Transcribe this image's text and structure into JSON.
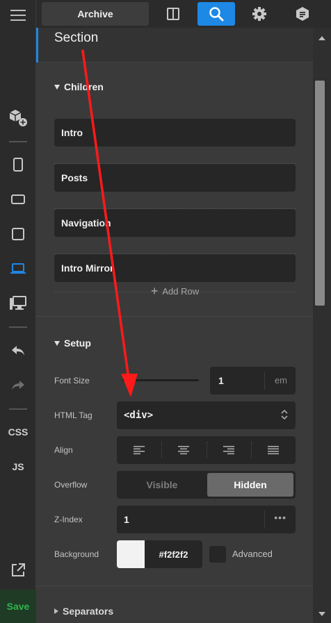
{
  "app": {
    "accent_color": "#1e88e5",
    "save_color": "#2fb34c"
  },
  "rail": {
    "items": [
      {
        "icon": "hamburger-menu-icon"
      },
      {
        "icon": "add-component-icon"
      },
      {
        "icon": "phone-portrait-icon"
      },
      {
        "icon": "phone-landscape-icon"
      },
      {
        "icon": "tablet-icon"
      },
      {
        "icon": "laptop-icon",
        "active": true
      },
      {
        "icon": "desktop-icon"
      },
      {
        "icon": "undo-icon"
      },
      {
        "icon": "redo-icon"
      },
      {
        "icon": "external-link-icon"
      }
    ],
    "css_label": "CSS",
    "js_label": "JS",
    "save_label": "Save"
  },
  "topbar": {
    "archive_label": "Archive",
    "icons": [
      "split-layout-icon",
      "search-icon",
      "settings-gear-icon",
      "notes-icon"
    ],
    "active_icon": "search-icon"
  },
  "section": {
    "title": "Section"
  },
  "children": {
    "title": "Children",
    "rows": [
      "Intro",
      "Posts",
      "Navigation",
      "Intro Mirror"
    ],
    "add_row_label": "Add Row"
  },
  "setup": {
    "title": "Setup",
    "font_size": {
      "label": "Font Size",
      "value": "1",
      "unit": "em",
      "slider_fraction": 0.1
    },
    "html_tag": {
      "label": "HTML Tag",
      "value": "<div>"
    },
    "align": {
      "label": "Align",
      "options": [
        "align-left-icon",
        "align-center-icon",
        "align-right-icon",
        "align-justify-icon"
      ]
    },
    "overflow": {
      "label": "Overflow",
      "options": [
        "Visible",
        "Hidden"
      ],
      "selected": "Hidden"
    },
    "z_index": {
      "label": "Z-Index",
      "value": "1"
    },
    "background": {
      "label": "Background",
      "color": "#f2f2f2",
      "hex_label": "#f2f2f2",
      "advanced_label": "Advanced"
    }
  },
  "separators": {
    "title": "Separators"
  },
  "annotation": {
    "arrow_color": "#ff1a1a"
  }
}
